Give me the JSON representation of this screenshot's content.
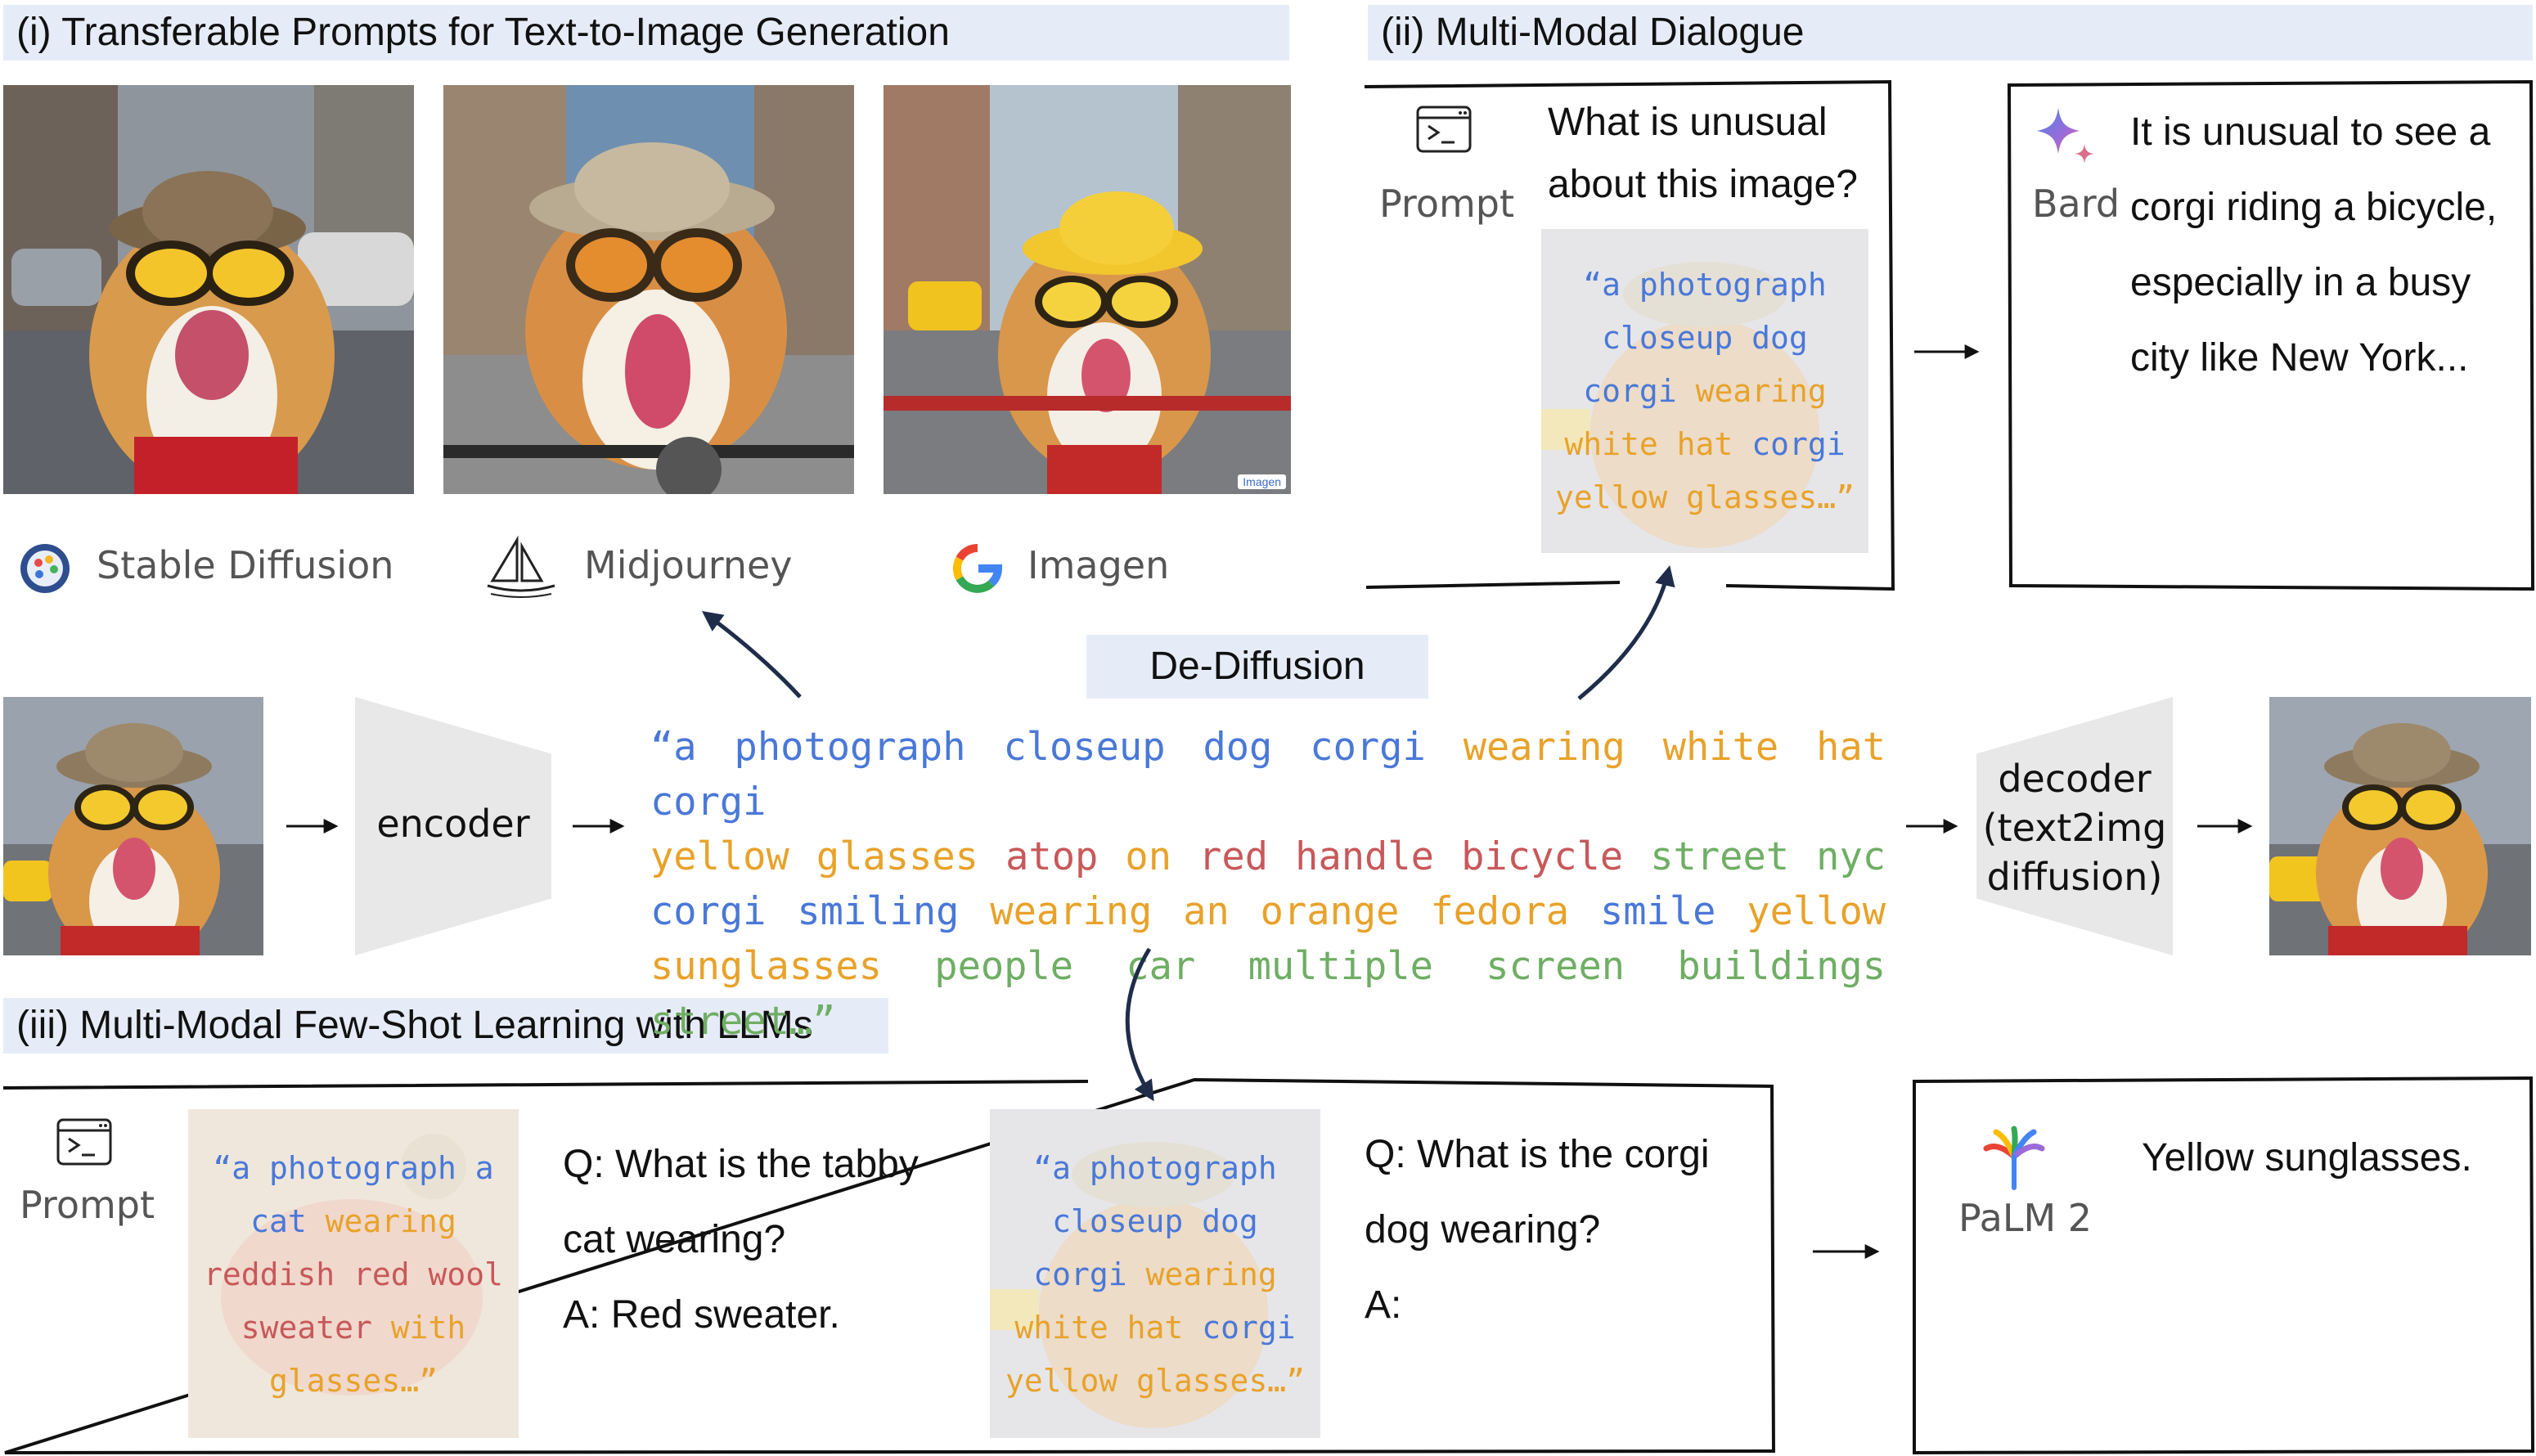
{
  "sections": {
    "transferable": "(i) Transferable Prompts for Text-to-Image Generation",
    "dialogue": "(ii) Multi-Modal Dialogue",
    "fewshot": "(iii) Multi-Modal Few-Shot Learning with LLMs"
  },
  "models": {
    "stable_diffusion": "Stable Diffusion",
    "midjourney": "Midjourney",
    "imagen": "Imagen",
    "imagen_watermark": "Imagen"
  },
  "center": {
    "dediffusion": "De-Diffusion",
    "encoder": "encoder",
    "decoder_lines": [
      "decoder",
      "(text2img",
      "diffusion)"
    ],
    "prompt_lines": [
      [
        {
          "t": "“a",
          "c": "blue"
        },
        {
          "t": "photograph",
          "c": "blue"
        },
        {
          "t": "closeup",
          "c": "blue"
        },
        {
          "t": "dog",
          "c": "blue"
        },
        {
          "t": "corgi",
          "c": "blue"
        },
        {
          "t": "wearing",
          "c": "orange"
        },
        {
          "t": "white",
          "c": "orange"
        },
        {
          "t": "hat",
          "c": "orange"
        },
        {
          "t": "corgi",
          "c": "blue"
        }
      ],
      [
        {
          "t": "yellow",
          "c": "orange"
        },
        {
          "t": "glasses",
          "c": "orange"
        },
        {
          "t": "atop",
          "c": "red"
        },
        {
          "t": "on",
          "c": "orange"
        },
        {
          "t": "red",
          "c": "red"
        },
        {
          "t": "handle",
          "c": "red"
        },
        {
          "t": "bicycle",
          "c": "red"
        },
        {
          "t": "street",
          "c": "green"
        },
        {
          "t": "nyc",
          "c": "green"
        }
      ],
      [
        {
          "t": "corgi",
          "c": "blue"
        },
        {
          "t": "smiling",
          "c": "blue"
        },
        {
          "t": "wearing",
          "c": "orange"
        },
        {
          "t": "an",
          "c": "orange"
        },
        {
          "t": "orange",
          "c": "orange"
        },
        {
          "t": "fedora",
          "c": "orange"
        },
        {
          "t": "smile",
          "c": "blue"
        },
        {
          "t": "yellow",
          "c": "orange"
        }
      ],
      [
        {
          "t": "sunglasses",
          "c": "orange"
        },
        {
          "t": "people",
          "c": "green"
        },
        {
          "t": "car",
          "c": "green"
        },
        {
          "t": "multiple",
          "c": "green"
        },
        {
          "t": "screen",
          "c": "green"
        },
        {
          "t": "buildings",
          "c": "green"
        },
        {
          "t": "street…”",
          "c": "green"
        }
      ]
    ]
  },
  "dialogue": {
    "prompt_label": "Prompt",
    "question_lines": [
      "What is unusual",
      "about this image?"
    ],
    "overlay_lines": [
      [
        {
          "t": "“a photograph",
          "c": "blue"
        }
      ],
      [
        {
          "t": "closeup dog",
          "c": "blue"
        }
      ],
      [
        {
          "t": "corgi ",
          "c": "blue"
        },
        {
          "t": "wearing",
          "c": "orange"
        }
      ],
      [
        {
          "t": "white hat ",
          "c": "orange"
        },
        {
          "t": "corgi",
          "c": "blue"
        }
      ],
      [
        {
          "t": "yellow glasses…”",
          "c": "orange"
        }
      ]
    ],
    "bard_label": "Bard",
    "answer_lines": [
      "It is unusual to see a",
      "corgi riding a bicycle,",
      "especially in a busy",
      "city like New York..."
    ]
  },
  "fewshot": {
    "prompt_label": "Prompt",
    "cat_overlay_lines": [
      [
        {
          "t": "“a photograph a",
          "c": "blue"
        }
      ],
      [
        {
          "t": "cat ",
          "c": "blue"
        },
        {
          "t": "wearing",
          "c": "orange"
        }
      ],
      [
        {
          "t": "reddish red wool",
          "c": "red"
        }
      ],
      [
        {
          "t": "sweater ",
          "c": "red"
        },
        {
          "t": "with",
          "c": "orange"
        }
      ],
      [
        {
          "t": "glasses…”",
          "c": "orange"
        }
      ]
    ],
    "qa1_lines": [
      "Q: What is the tabby",
      "cat wearing?",
      "A: Red sweater."
    ],
    "dog_overlay_lines": [
      [
        {
          "t": "“a photograph",
          "c": "blue"
        }
      ],
      [
        {
          "t": "closeup dog",
          "c": "blue"
        }
      ],
      [
        {
          "t": "corgi ",
          "c": "blue"
        },
        {
          "t": "wearing",
          "c": "orange"
        }
      ],
      [
        {
          "t": "white hat ",
          "c": "orange"
        },
        {
          "t": "corgi",
          "c": "blue"
        }
      ],
      [
        {
          "t": "yellow glasses…”",
          "c": "orange"
        }
      ]
    ],
    "qa2_lines": [
      "Q: What is the corgi",
      "dog wearing?",
      "A:"
    ],
    "palm_label": "PaLM 2",
    "answer": "Yellow sunglasses."
  },
  "colors": {
    "blue": "#4a78d8",
    "orange": "#e8a22a",
    "red": "#c8585a",
    "green": "#6fae64",
    "header_bg": "#e6ecf7",
    "arrow": "#1f2d4a"
  },
  "icons": [
    "stable-diffusion-logo",
    "midjourney-logo",
    "google-logo",
    "terminal-icon",
    "bard-sparkle-icon",
    "palm-tree-icon"
  ]
}
